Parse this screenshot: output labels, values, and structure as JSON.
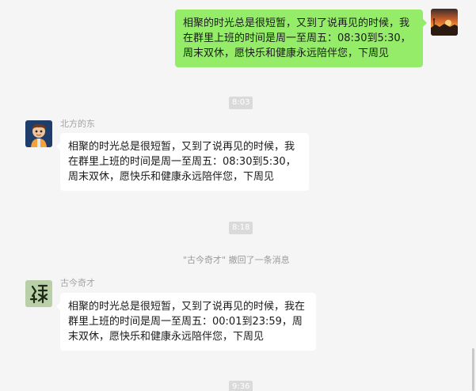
{
  "messages": [
    {
      "side": "self",
      "avatar_icon": "sunset-avatar-icon",
      "text": "相聚的时光总是很短暂，又到了说再见的时候，我在群里上班的时间是周一至周五：08:30到5:30，周末双休，愿快乐和健康永远陪伴您，下周见"
    },
    {
      "time": "8:03"
    },
    {
      "side": "other",
      "sender": "北方的东",
      "avatar_icon": "cartoon-boy-avatar-icon",
      "text": "相聚的时光总是很短暂，又到了说再见的时候，我在群里上班的时间是周一至周五：08:30到5:30，周末双休，愿快乐和健康永远陪伴您，下周见"
    },
    {
      "time": "8:18"
    },
    {
      "system": "\"古今奇才\" 撤回了一条消息"
    },
    {
      "side": "other",
      "sender": "古今奇才",
      "avatar_icon": "calligraphy-avatar-icon",
      "text": "相聚的时光总是很短暂，又到了说再见的时候，我在群里上班的时间是周一至周五：00:01到23:59，周末双休，愿快乐和健康永远陪伴您，下周见"
    },
    {
      "time": "9:36"
    }
  ],
  "colors": {
    "background": "#f5f5f5",
    "self_bubble": "#95ec69",
    "other_bubble": "#ffffff",
    "time_chip": "#dadada",
    "name_text": "#a3a3a3"
  }
}
